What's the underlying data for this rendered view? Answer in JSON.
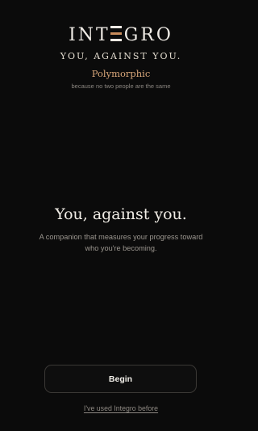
{
  "brand": {
    "name_prefix": "INT",
    "name_suffix": "GRO",
    "logo_icon": "triple-bar-e-icon",
    "accent_color": "#c98c5b",
    "tagline": "YOU, AGAINST YOU."
  },
  "mode": {
    "name": "Polymorphic",
    "subtitle": "because no two people are the same"
  },
  "hero": {
    "title": "You, against you.",
    "description": "A companion that measures your progress toward who you're becoming."
  },
  "actions": {
    "begin_label": "Begin",
    "returning_label": "I've used Integro before"
  },
  "colors": {
    "background": "#0b0b0b",
    "accent": "#d9a77a",
    "text_primary": "#f1ede6",
    "text_muted": "#9b968f"
  }
}
